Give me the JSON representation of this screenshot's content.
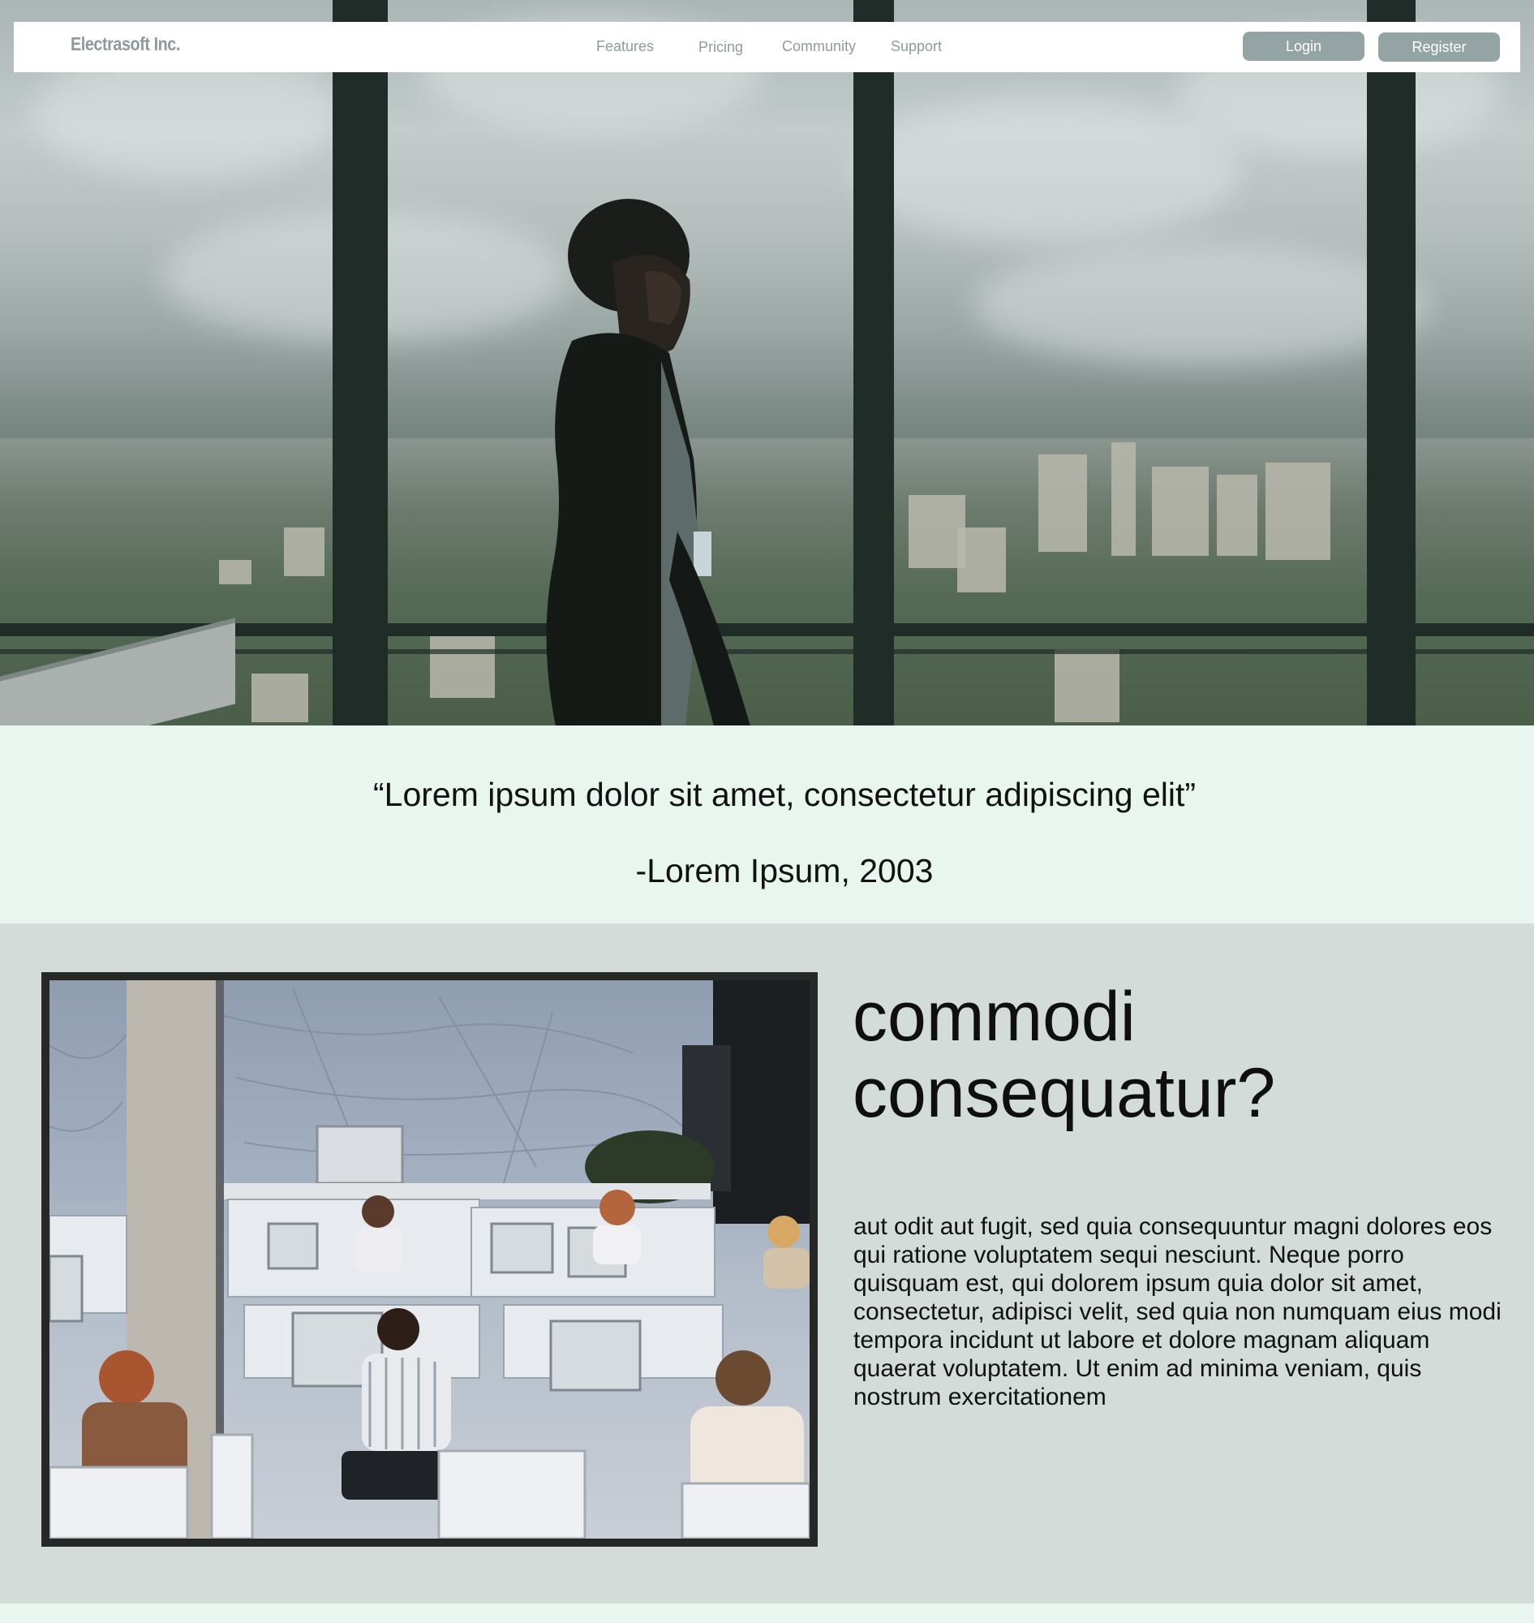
{
  "nav": {
    "brand": "Electrasoft Inc.",
    "links": [
      "Features",
      "Pricing",
      "Community",
      "Support"
    ],
    "login_label": "Login",
    "register_label": "Register"
  },
  "hero": {
    "image": "man-walking-by-office-window-photo"
  },
  "quote": {
    "text": "“Lorem ipsum dolor sit amet, consectetur adipiscing elit”",
    "author": "-Lorem Ipsum, 2003"
  },
  "feature": {
    "image": "call-center-office-photo",
    "heading_line1": "commodi",
    "heading_line2": "consequatur?",
    "body": "aut odit aut fugit, sed quia consequuntur magni dolores eos qui ratione voluptatem sequi nesciunt. Neque porro quisquam est, qui dolorem ipsum quia dolor sit amet, consectetur, adipisci velit, sed quia non numquam eius modi tempora incidunt ut labore et dolore magnam aliquam quaerat voluptatem. Ut enim ad minima veniam, quis nostrum exercitationem"
  },
  "colors": {
    "nav_text": "#8f9b9b",
    "button_bg": "#94a3a3",
    "quote_bg": "#e9f6ef",
    "feature_bg": "#d3dcd8",
    "frame": "#262826"
  }
}
